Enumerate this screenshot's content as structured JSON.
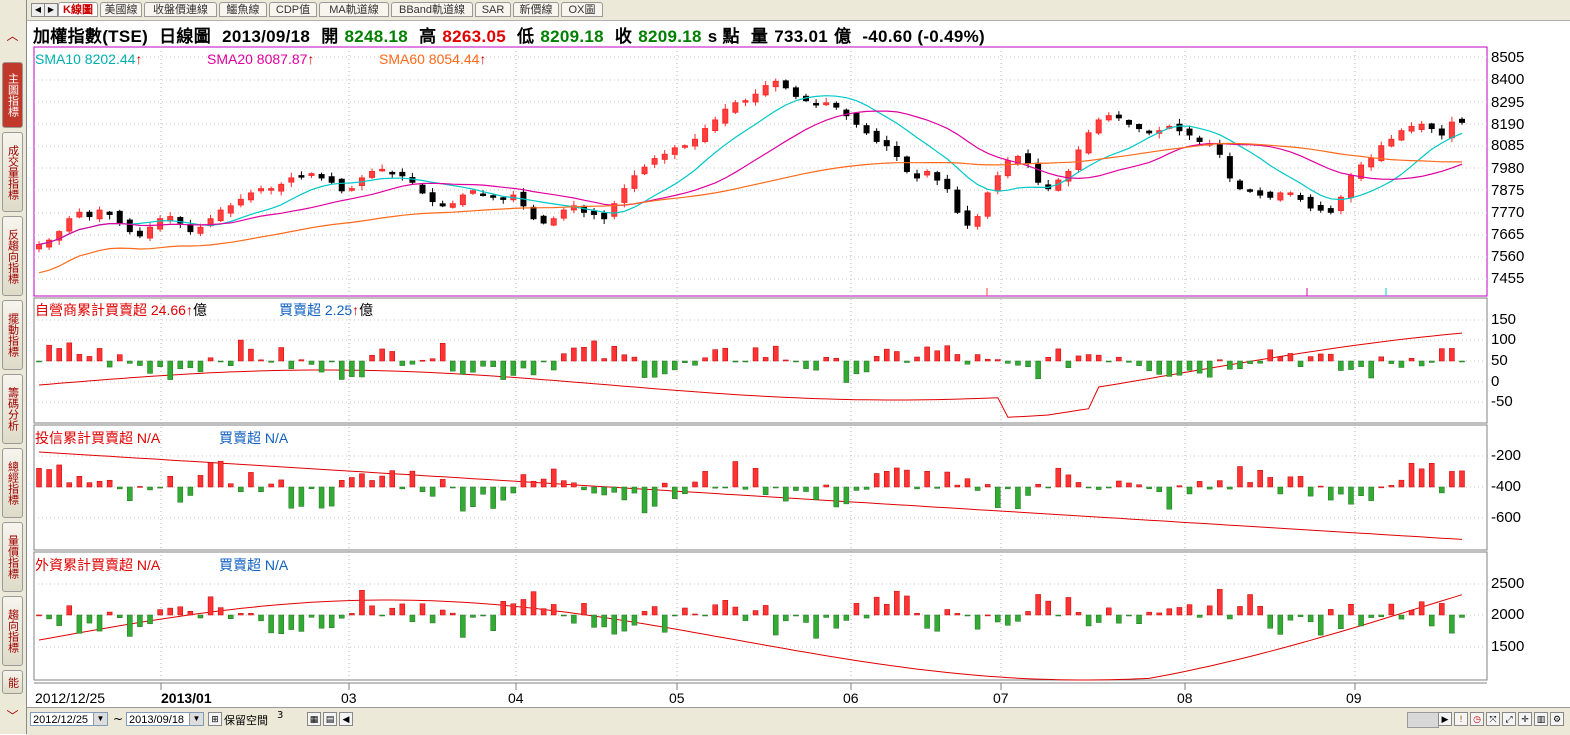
{
  "tabs": [
    "K線圖",
    "美國線",
    "收盤價連線",
    "鱷魚線",
    "CDP值",
    "MA軌道線",
    "BBand軌道線",
    "SAR",
    "新價線",
    "OX圖"
  ],
  "left_tabs": [
    "主圖指標",
    "成交量指標",
    "反趨向指標",
    "擺動指標",
    "籌碼分析",
    "總經指標",
    "量價指標",
    "趨向指標",
    "能"
  ],
  "header": {
    "title": "加權指數(TSE)",
    "period": "日線圖",
    "date": "2013/09/18",
    "open_label": "開",
    "open": "8248.18",
    "high_label": "高",
    "high": "8263.05",
    "low_label": "低",
    "low": "8209.18",
    "close_label": "收",
    "close": "8209.18",
    "unit": "s 點",
    "vol_label": "量",
    "volume": "733.01",
    "vol_unit": "億",
    "change": "-40.60 (-0.49%)"
  },
  "legend": {
    "sma10": "SMA10 8202.44",
    "sma20": "SMA20 8087.87",
    "sma60": "SMA60 8054.44",
    "arrow": "↑",
    "p2_label": "自營商累計買賣超",
    "p2_value": "24.66",
    "p2_unit": "億",
    "p2_net_label": "買賣超",
    "p2_net_value": "2.25",
    "p3_label": "投信累計買賣超",
    "p3_value": "N/A",
    "p3_net_label": "買賣超",
    "p3_net_value": "N/A",
    "p4_label": "外資累計買賣超",
    "p4_value": "N/A",
    "p4_net_label": "買賣超",
    "p4_net_value": "N/A"
  },
  "y_axes": {
    "main": [
      "8505",
      "8400",
      "8295",
      "8190",
      "8085",
      "7980",
      "7875",
      "7770",
      "7665",
      "7560",
      "7455"
    ],
    "p2": [
      "150",
      "100",
      "50",
      "0",
      "-50"
    ],
    "p3": [
      "-200",
      "-400",
      "-600"
    ],
    "p4": [
      "2500",
      "2000",
      "1500"
    ]
  },
  "x_axis": [
    "2012/12/25",
    "2013/01",
    "03",
    "04",
    "05",
    "06",
    "07",
    "08",
    "09"
  ],
  "bottom": {
    "start_date": "2012/12/25",
    "tilde": "~",
    "end_date": "2013/09/18",
    "reserve_label": "保留空間",
    "reserve_value": "3"
  },
  "colors": {
    "up": "#ff3333",
    "down": "#33aa33",
    "sma10": "#00c8c8",
    "sma20": "#e000a0",
    "sma60": "#ff6a1a",
    "frame_main": "#c000c0",
    "frame": "#808080"
  },
  "chart_data": {
    "type": "candlestick",
    "note_units": "index points",
    "main_ylim": [
      7400,
      8560
    ],
    "closes_approx": [
      7640,
      7660,
      7700,
      7760,
      7790,
      7770,
      7800,
      7780,
      7740,
      7700,
      7680,
      7720,
      7760,
      7770,
      7740,
      7700,
      7720,
      7760,
      7800,
      7820,
      7850,
      7880,
      7900,
      7900,
      7920,
      7950,
      7960,
      7970,
      7950,
      7930,
      7890,
      7900,
      7950,
      7980,
      7990,
      7970,
      7960,
      7930,
      7880,
      7840,
      7820,
      7830,
      7870,
      7890,
      7870,
      7860,
      7850,
      7870,
      7820,
      7760,
      7740,
      7760,
      7800,
      7820,
      7790,
      7780,
      7760,
      7830,
      7900,
      7960,
      8000,
      8040,
      8060,
      8090,
      8100,
      8130,
      8180,
      8220,
      8270,
      8300,
      8310,
      8340,
      8380,
      8400,
      8370,
      8330,
      8310,
      8290,
      8300,
      8280,
      8240,
      8200,
      8160,
      8120,
      8100,
      8050,
      7980,
      7950,
      7980,
      7940,
      7900,
      7790,
      7730,
      7770,
      7880,
      7960,
      8030,
      8050,
      8020,
      7930,
      7900,
      7940,
      7980,
      8080,
      8160,
      8220,
      8240,
      8230,
      8200,
      8180,
      8160,
      8170,
      8190,
      8170,
      8150,
      8120,
      8110,
      8060,
      7950,
      7900,
      7890,
      7870,
      7860,
      7880,
      7880,
      7850,
      7810,
      7800,
      7790,
      7860,
      7960,
      8010,
      8040,
      8100,
      8130,
      8170,
      8190,
      8200,
      8180,
      8150,
      8210,
      8209
    ]
  }
}
